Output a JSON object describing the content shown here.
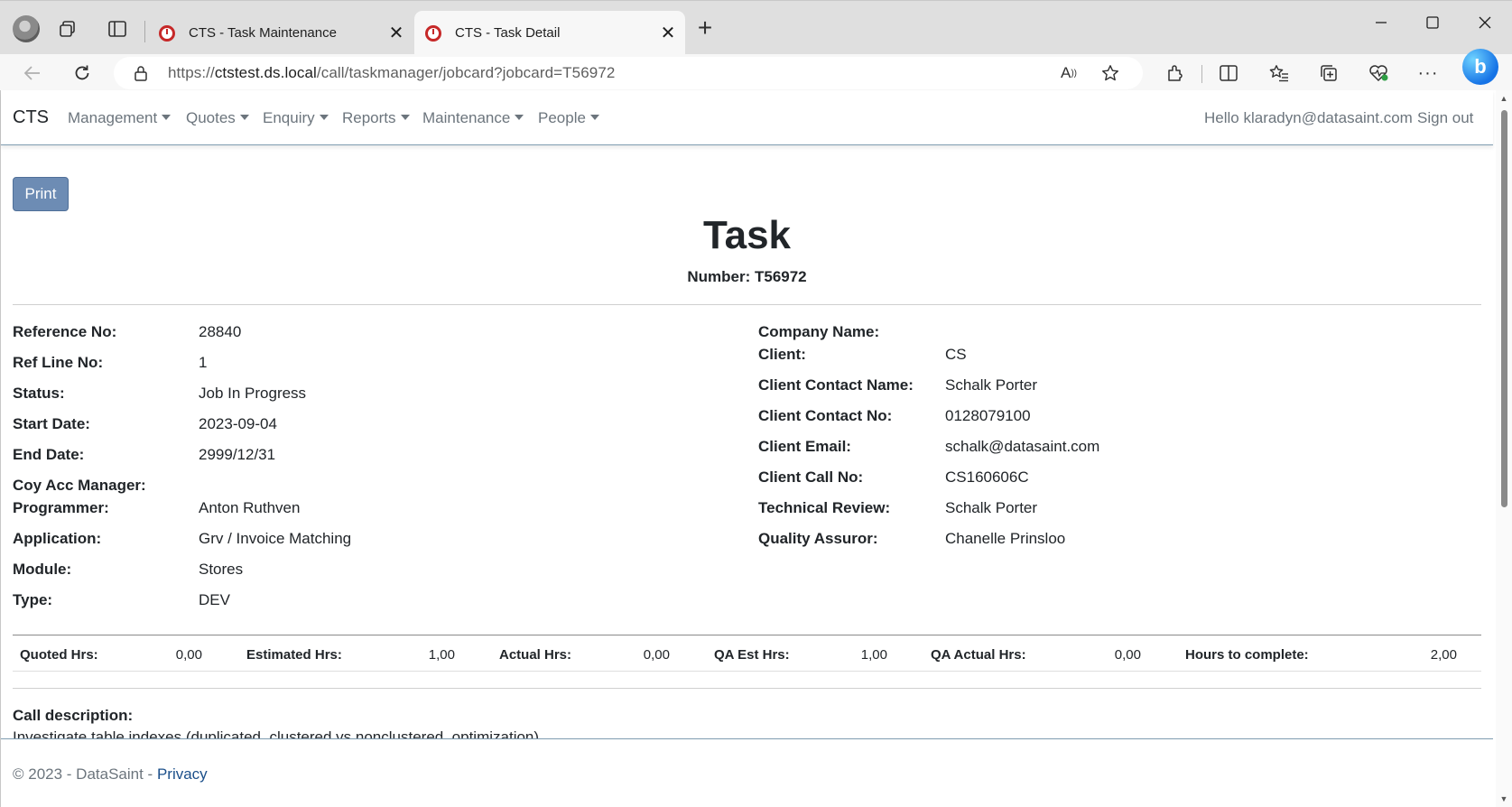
{
  "browser": {
    "tabs": [
      {
        "title": "CTS - Task Maintenance",
        "active": false
      },
      {
        "title": "CTS - Task Detail",
        "active": true
      }
    ],
    "url_prefix": "https://",
    "url_host": "ctstest.ds.local",
    "url_path": "/call/taskmanager/jobcard?jobcard=T56972"
  },
  "navbar": {
    "brand": "CTS",
    "menus": [
      "Management",
      "Quotes",
      "Enquiry",
      "Reports",
      "Maintenance",
      "People"
    ],
    "greeting": "Hello klaradyn@datasaint.com",
    "signout": "Sign out"
  },
  "page": {
    "print_label": "Print",
    "title": "Task",
    "number_label": "Number: T56972"
  },
  "left_fields": [
    {
      "label": "Reference No:",
      "value": "28840"
    },
    {
      "label": "Ref Line No:",
      "value": "1"
    },
    {
      "label": "Status:",
      "value": "Job In Progress"
    },
    {
      "label": "Start Date:",
      "value": "2023-09-04"
    },
    {
      "label": "End Date:",
      "value": "2999/12/31"
    },
    {
      "label": "Coy Acc Manager:",
      "value": ""
    },
    {
      "label": "Programmer:",
      "value": "Anton Ruthven"
    },
    {
      "label": "Application:",
      "value": "Grv / Invoice Matching"
    },
    {
      "label": "Module:",
      "value": "Stores"
    },
    {
      "label": "Type:",
      "value": "DEV"
    }
  ],
  "right_fields": [
    {
      "label": "Company Name:",
      "value": ""
    },
    {
      "label": "Client:",
      "value": "CS"
    },
    {
      "label": "Client Contact Name:",
      "value": "Schalk Porter"
    },
    {
      "label": "Client Contact No:",
      "value": "0128079100"
    },
    {
      "label": "Client Email:",
      "value": "schalk@datasaint.com"
    },
    {
      "label": "Client Call No:",
      "value": "CS160606C"
    },
    {
      "label": "Technical Review:",
      "value": "Schalk Porter"
    },
    {
      "label": "Quality Assuror:",
      "value": "Chanelle Prinsloo"
    }
  ],
  "hours": [
    {
      "label": "Quoted Hrs:",
      "value": "0,00"
    },
    {
      "label": "Estimated Hrs:",
      "value": "1,00"
    },
    {
      "label": "Actual Hrs:",
      "value": "0,00"
    },
    {
      "label": "QA Est Hrs:",
      "value": "1,00"
    },
    {
      "label": "QA Actual Hrs:",
      "value": "0,00"
    },
    {
      "label": "Hours to complete:",
      "value": "2,00"
    }
  ],
  "description": {
    "label": "Call description:",
    "text": "Investigate table indexes (duplicated, clustered vs nonclustered, optimization)"
  },
  "footer": {
    "copyright": "© 2023 - DataSaint - ",
    "privacy": "Privacy"
  }
}
